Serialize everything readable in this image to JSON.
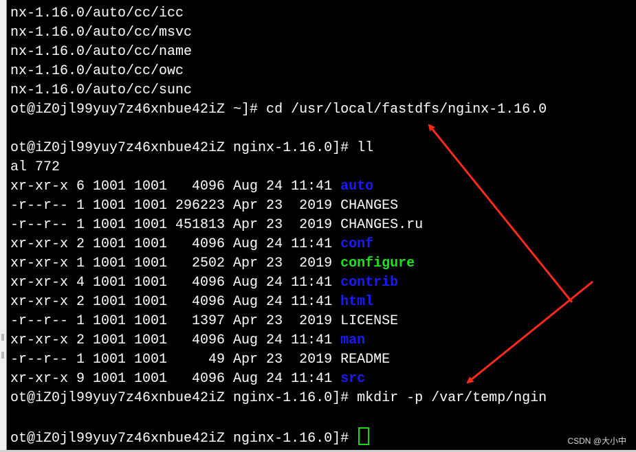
{
  "terminal": {
    "lines": [
      {
        "segments": [
          {
            "text": "nx-1.16.0/auto/cc/icc",
            "color": "white"
          }
        ]
      },
      {
        "segments": [
          {
            "text": "nx-1.16.0/auto/cc/msvc",
            "color": "white"
          }
        ]
      },
      {
        "segments": [
          {
            "text": "nx-1.16.0/auto/cc/name",
            "color": "white"
          }
        ]
      },
      {
        "segments": [
          {
            "text": "nx-1.16.0/auto/cc/owc",
            "color": "white"
          }
        ]
      },
      {
        "segments": [
          {
            "text": "nx-1.16.0/auto/cc/sunc",
            "color": "white"
          }
        ]
      },
      {
        "segments": [
          {
            "text": "ot@iZ0jl99yuy7z46xnbue42iZ ~]# cd /usr/local/fastdfs/nginx-1.16.0",
            "color": "white"
          }
        ]
      },
      {
        "segments": [
          {
            "text": "",
            "color": "white"
          }
        ]
      },
      {
        "segments": [
          {
            "text": "ot@iZ0jl99yuy7z46xnbue42iZ nginx-1.16.0]# ll",
            "color": "white"
          }
        ]
      },
      {
        "segments": [
          {
            "text": "al 772",
            "color": "white"
          }
        ]
      },
      {
        "segments": [
          {
            "text": "xr-xr-x 6 1001 1001   4096 Aug 24 11:41 ",
            "color": "white"
          },
          {
            "text": "auto",
            "color": "blue"
          }
        ]
      },
      {
        "segments": [
          {
            "text": "-r--r-- 1 1001 1001 296223 Apr 23  2019 CHANGES",
            "color": "white"
          }
        ]
      },
      {
        "segments": [
          {
            "text": "-r--r-- 1 1001 1001 451813 Apr 23  2019 CHANGES.ru",
            "color": "white"
          }
        ]
      },
      {
        "segments": [
          {
            "text": "xr-xr-x 2 1001 1001   4096 Aug 24 11:41 ",
            "color": "white"
          },
          {
            "text": "conf",
            "color": "blue"
          }
        ]
      },
      {
        "segments": [
          {
            "text": "xr-xr-x 1 1001 1001   2502 Apr 23  2019 ",
            "color": "white"
          },
          {
            "text": "configure",
            "color": "green"
          }
        ]
      },
      {
        "segments": [
          {
            "text": "xr-xr-x 4 1001 1001   4096 Aug 24 11:41 ",
            "color": "white"
          },
          {
            "text": "contrib",
            "color": "blue"
          }
        ]
      },
      {
        "segments": [
          {
            "text": "xr-xr-x 2 1001 1001   4096 Aug 24 11:41 ",
            "color": "white"
          },
          {
            "text": "html",
            "color": "blue"
          }
        ]
      },
      {
        "segments": [
          {
            "text": "-r--r-- 1 1001 1001   1397 Apr 23  2019 LICENSE",
            "color": "white"
          }
        ]
      },
      {
        "segments": [
          {
            "text": "xr-xr-x 2 1001 1001   4096 Aug 24 11:41 ",
            "color": "white"
          },
          {
            "text": "man",
            "color": "blue"
          }
        ]
      },
      {
        "segments": [
          {
            "text": "-r--r-- 1 1001 1001     49 Apr 23  2019 README",
            "color": "white"
          }
        ]
      },
      {
        "segments": [
          {
            "text": "xr-xr-x 9 1001 1001   4096 Aug 24 11:41 ",
            "color": "white"
          },
          {
            "text": "src",
            "color": "blue"
          }
        ]
      },
      {
        "segments": [
          {
            "text": "ot@iZ0jl99yuy7z46xnbue42iZ nginx-1.16.0]# mkdir -p /var/temp/ngin",
            "color": "white"
          }
        ]
      },
      {
        "segments": [
          {
            "text": "",
            "color": "white"
          }
        ]
      },
      {
        "segments": [
          {
            "text": "ot@iZ0jl99yuy7z46xnbue42iZ nginx-1.16.0]# ",
            "color": "white"
          }
        ],
        "cursor": true
      }
    ]
  },
  "watermark": "CSDN @大小中",
  "colors": {
    "background": "#000000",
    "text": "#ffffff",
    "directory": "#1a1aff",
    "executable": "#1ee01e",
    "cursor": "#19d719",
    "annotation_arrow": "#ff2a1a"
  },
  "icons": {
    "annotation_arrows": "red-arrow-icon"
  }
}
